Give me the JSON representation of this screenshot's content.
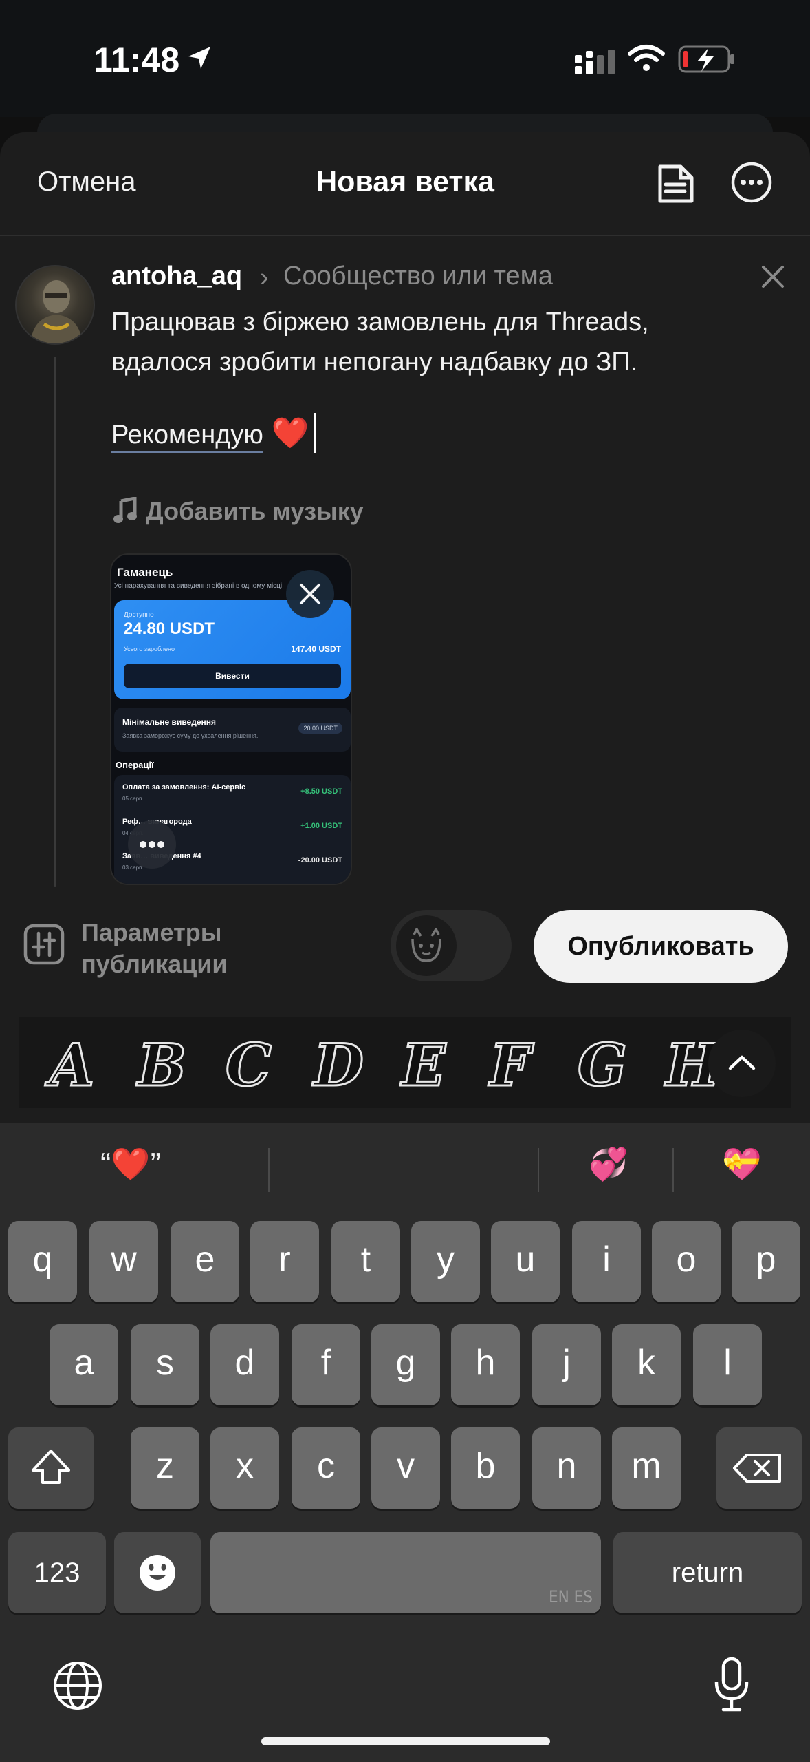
{
  "status_bar": {
    "time": "11:48"
  },
  "header": {
    "cancel": "Отмена",
    "title": "Новая ветка"
  },
  "post": {
    "username": "antoha_aq",
    "chevron": "›",
    "topic_placeholder": "Сообщество или тема",
    "line1": "Працював з біржею замовлень для Threads,",
    "line2": "вдалося зробити непогану надбавку до ЗП.",
    "line3": "Рекомендую",
    "heart": "❤️",
    "music": "Добавить музыку"
  },
  "attachment": {
    "title": "Гаманець",
    "subtitle": "Усі нарахування та виведення зібрані в одному місці",
    "available_label": "Доступно",
    "available": "24.80 USDT",
    "earned_label": "Усього зароблено",
    "earned": "147.40 USDT",
    "withdraw": "Вивести",
    "min_title": "Мінімальне виведення",
    "min_sub": "Заявка заморожує суму до ухвалення рішення.",
    "min_badge": "20.00 USDT",
    "ops_title": "Операції",
    "ops": [
      {
        "name": "Оплата за замовлення: AI-сервіс",
        "date": "05 серп.",
        "value": "+8.50 USDT",
        "color": "#35c27a"
      },
      {
        "name": "Реф…         винагорода",
        "date": "04 серп.",
        "value": "+1.00 USDT",
        "color": "#35c27a"
      },
      {
        "name": "Заяв…    виведення #4",
        "date": "03 серп.",
        "value": "-20.00 USDT",
        "color": "#e8e8e8"
      }
    ]
  },
  "publish_row": {
    "params_line1": "Параметры",
    "params_line2": "публикации",
    "publish": "Опубликовать"
  },
  "font_strip": {
    "letters": [
      "A",
      "B",
      "C",
      "D",
      "E",
      "F",
      "G",
      "H"
    ]
  },
  "keyboard": {
    "suggestion_left": "“❤️”",
    "suggestion_mid": "💞",
    "suggestion_right": "💝",
    "row1": [
      "q",
      "w",
      "e",
      "r",
      "t",
      "y",
      "u",
      "i",
      "o",
      "p"
    ],
    "row2": [
      "a",
      "s",
      "d",
      "f",
      "g",
      "h",
      "j",
      "k",
      "l"
    ],
    "row3": [
      "z",
      "x",
      "c",
      "v",
      "b",
      "n",
      "m"
    ],
    "numbers_key": "123",
    "return_key": "return",
    "space_lang": "EN ES"
  },
  "colors": {
    "accent_blue": "#2f8ff3",
    "sheet_bg": "#1d1d1d",
    "keyboard_bg": "#2b2b2b"
  }
}
